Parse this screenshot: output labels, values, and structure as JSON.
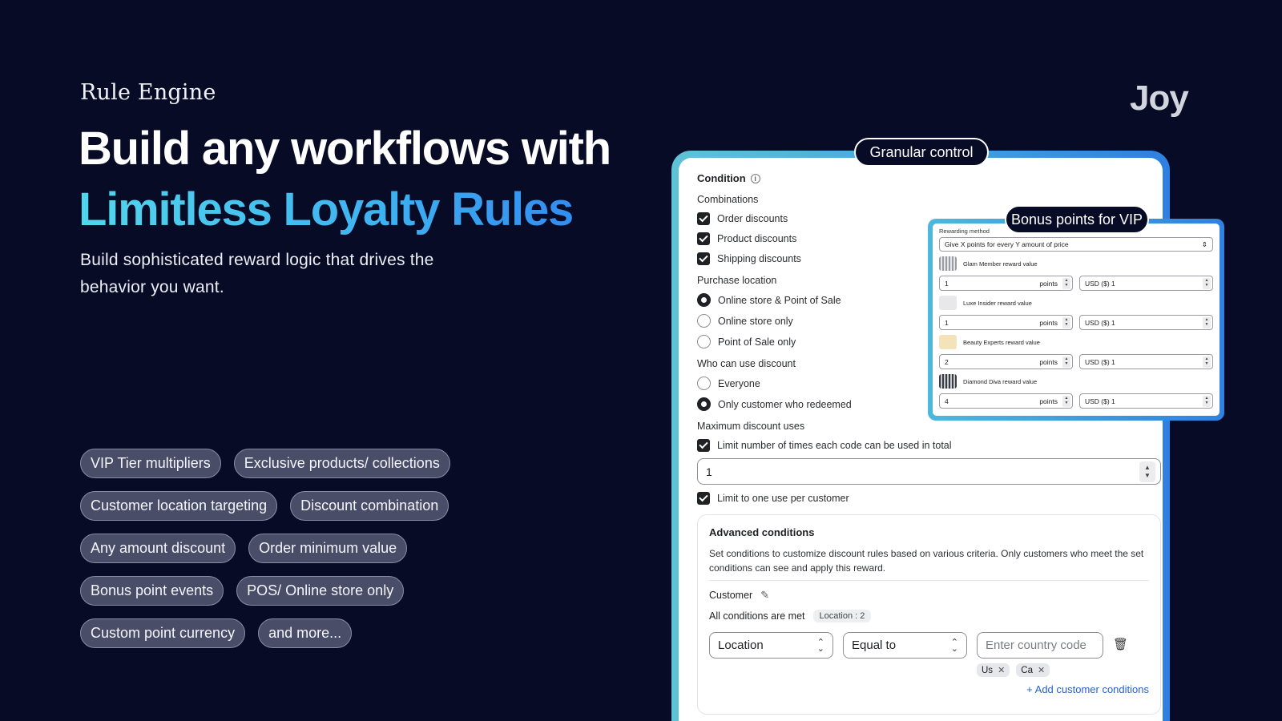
{
  "hero": {
    "eyebrow": "Rule Engine",
    "headline_line1": "Build any workflows with",
    "headline_line2": "Limitless Loyalty Rules",
    "subhead": "Build sophisticated reward logic that drives the behavior you want."
  },
  "logo": {
    "text": "Joy"
  },
  "features": [
    [
      "VIP Tier multipliers",
      "Exclusive products/ collections"
    ],
    [
      "Customer location targeting",
      "Discount combination"
    ],
    [
      "Any amount discount",
      "Order minimum value"
    ],
    [
      "Bonus point events",
      "POS/ Online store only"
    ],
    [
      "Custom point currency",
      "and more..."
    ]
  ],
  "main_card": {
    "badge": "Granular control",
    "title": "Condition",
    "combinations": {
      "label": "Combinations",
      "options": [
        "Order discounts",
        "Product discounts",
        "Shipping discounts"
      ]
    },
    "purchase_location": {
      "label": "Purchase location",
      "options": [
        "Online store & Point of Sale",
        "Online store only",
        "Point of Sale only"
      ],
      "selected": "Online store & Point of Sale"
    },
    "who_can_use": {
      "label": "Who can use discount",
      "options": [
        "Everyone",
        "Only customer who redeemed"
      ],
      "selected": "Only customer who redeemed"
    },
    "max_uses": {
      "label": "Maximum discount uses",
      "limit_total_label": "Limit number of times each code can be used in total",
      "limit_value": "1",
      "limit_per_customer_label": "Limit to one use per customer"
    },
    "advanced": {
      "title": "Advanced conditions",
      "description": "Set conditions to customize discount rules based on various criteria. Only customers who meet the set conditions can see and apply this reward.",
      "customer_label": "Customer",
      "all_met_label": "All conditions are met",
      "location_badge": "Location : 2",
      "field_select": "Location",
      "operator_select": "Equal to",
      "country_placeholder": "Enter country code",
      "tokens": [
        "Us",
        "Ca"
      ],
      "add_link": "+ Add customer conditions"
    }
  },
  "vip_card": {
    "badge": "Bonus points for VIP",
    "method_label": "Rewarding method",
    "method_value": "Give X points for every Y amount of price",
    "tiers": [
      {
        "name": "Glam Member reward value",
        "points": "1",
        "unit": "points",
        "currency": "USD ($) 1",
        "thumb": "bars"
      },
      {
        "name": "Luxe Insider reward value",
        "points": "1",
        "unit": "points",
        "currency": "USD ($) 1",
        "thumb": "plain"
      },
      {
        "name": "Beauty Experts reward value",
        "points": "2",
        "unit": "points",
        "currency": "USD ($) 1",
        "thumb": "gold"
      },
      {
        "name": "Diamond Diva reward value",
        "points": "4",
        "unit": "points",
        "currency": "USD ($) 1",
        "thumb": "dark"
      }
    ]
  },
  "colors": {
    "background": "#080b26",
    "accent_gradient_start": "#52d6ec",
    "accent_gradient_end": "#2f86f0",
    "chip_bg": "#4a4d68",
    "link": "#2563c9"
  }
}
